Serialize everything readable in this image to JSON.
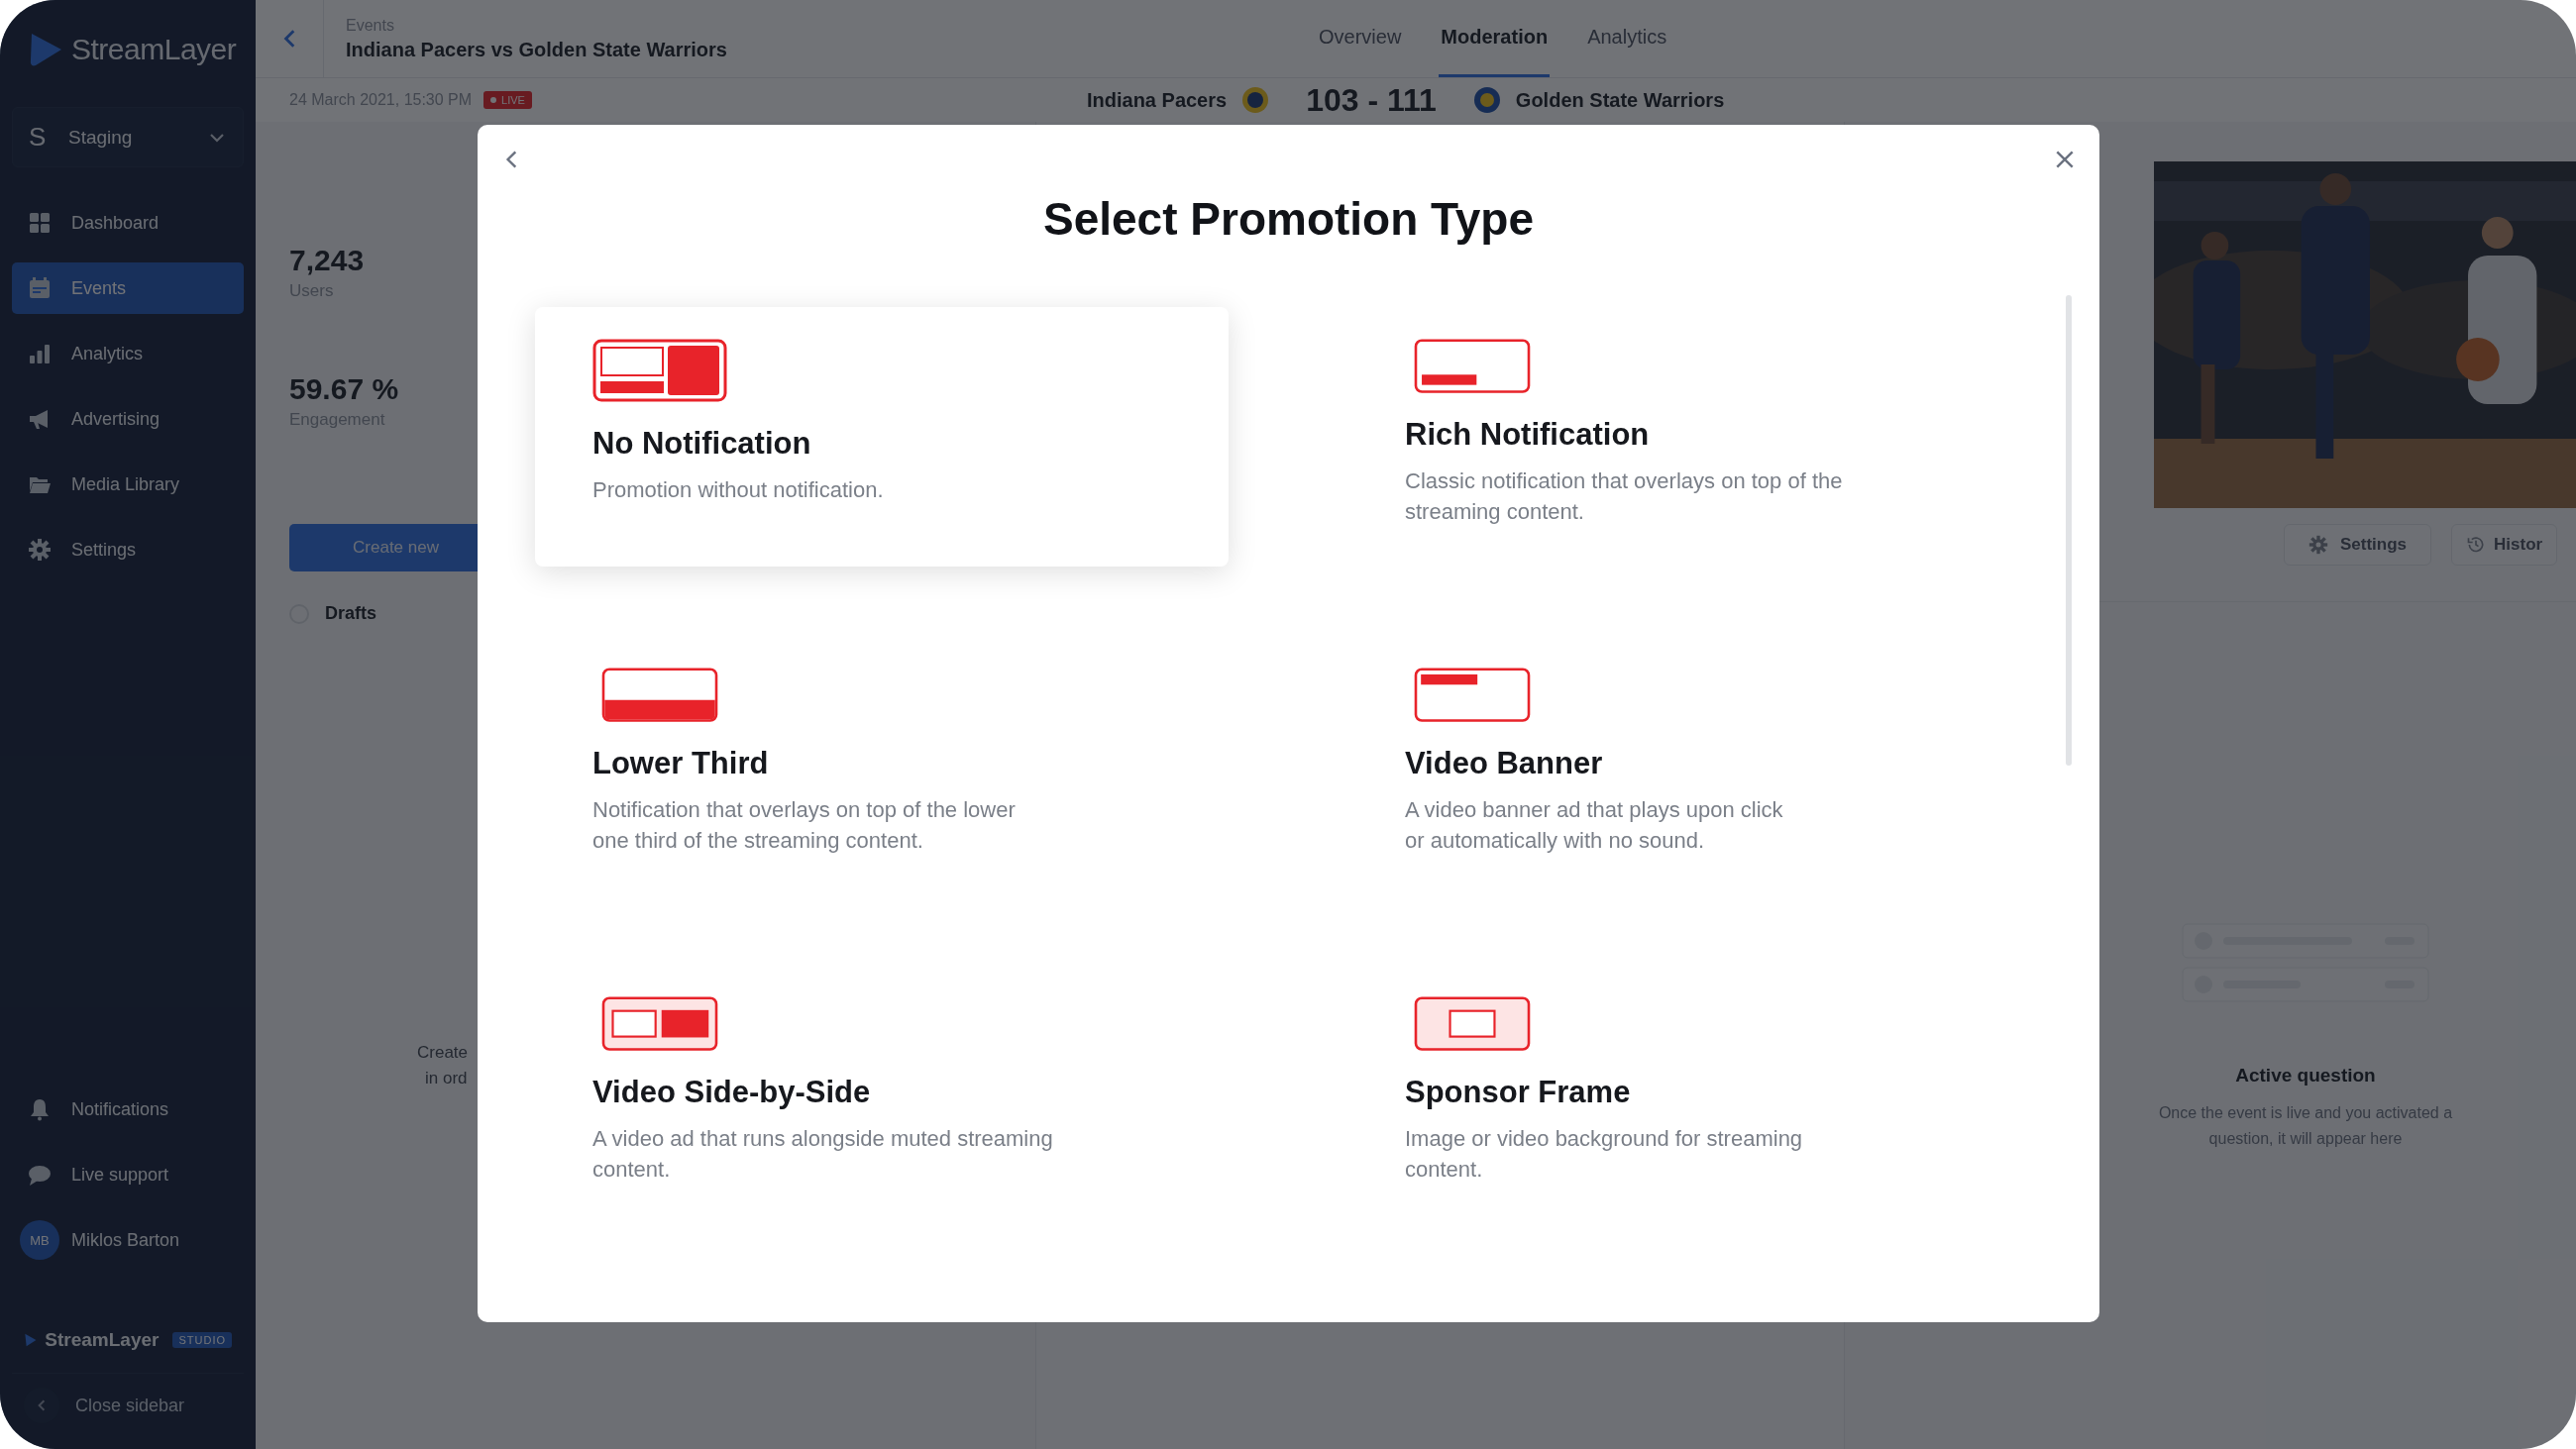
{
  "sidebar": {
    "logo": "StreamLayer",
    "workspace": {
      "initial": "S",
      "name": "Staging"
    },
    "nav": [
      {
        "label": "Dashboard",
        "kind": "grid",
        "selected": false
      },
      {
        "label": "Events",
        "kind": "calendar",
        "selected": true
      },
      {
        "label": "Analytics",
        "kind": "bars",
        "selected": false
      },
      {
        "label": "Advertising",
        "kind": "megaphone",
        "selected": false
      },
      {
        "label": "Media Library",
        "kind": "folder",
        "selected": false
      },
      {
        "label": "Settings",
        "kind": "gear",
        "selected": false
      }
    ],
    "bottom_nav": [
      {
        "label": "Notifications",
        "kind": "bell"
      },
      {
        "label": "Live support",
        "kind": "chat"
      }
    ],
    "user": {
      "initials": "MB",
      "name": "Miklos Barton"
    },
    "brand": {
      "name": "StreamLayer",
      "badge": "STUDIO"
    },
    "close_label": "Close sidebar"
  },
  "header": {
    "breadcrumb": "Events",
    "title": "Indiana Pacers vs Golden State Warriors",
    "tabs": [
      {
        "label": "Overview",
        "selected": false
      },
      {
        "label": "Moderation",
        "selected": true
      },
      {
        "label": "Analytics",
        "selected": false
      }
    ]
  },
  "event": {
    "date": "24 March 2021, 15:30 PM",
    "status": "LIVE",
    "home_team": "Indiana Pacers",
    "score": "103 - 111",
    "away_team": "Golden State Warriors"
  },
  "stats": [
    {
      "value": "7,243",
      "label": "Users"
    },
    {
      "value": "59.67 %",
      "label": "Engagement"
    }
  ],
  "create_button": "Create new",
  "drafts": "Drafts",
  "drafts_selected": false,
  "hint_lines": [
    "Create",
    "in ord"
  ],
  "video_actions": [
    {
      "label": "Settings",
      "kind": "gear"
    },
    {
      "label": "Histor",
      "kind": "history"
    }
  ],
  "active_question": {
    "title": "Active question",
    "text": "Once the event is live and you activated a question, it will appear here"
  },
  "modal": {
    "title": "Select Promotion Type",
    "options": [
      {
        "kind": "split",
        "title": "No Notification",
        "description": [
          "Promotion without notification."
        ],
        "selected": true
      },
      {
        "kind": "rich",
        "title": "Rich Notification",
        "description": [
          "Classic notification that overlays on top of the",
          "streaming content."
        ],
        "selected": false
      },
      {
        "kind": "lower",
        "title": "Lower Third",
        "description": [
          "Notification that overlays on top of the lower",
          "one third of the streaming content."
        ],
        "selected": false
      },
      {
        "kind": "banner",
        "title": "Video Banner",
        "description": [
          "A video banner ad that plays upon click",
          "or automatically with no sound."
        ],
        "selected": false
      },
      {
        "kind": "side",
        "title": "Video Side-by-Side",
        "description": [
          "A video ad that runs alongside muted streaming",
          "content."
        ],
        "selected": false
      },
      {
        "kind": "frame",
        "title": "Sponsor Frame",
        "description": [
          "Image or video background for streaming",
          "content."
        ],
        "selected": false
      }
    ]
  }
}
